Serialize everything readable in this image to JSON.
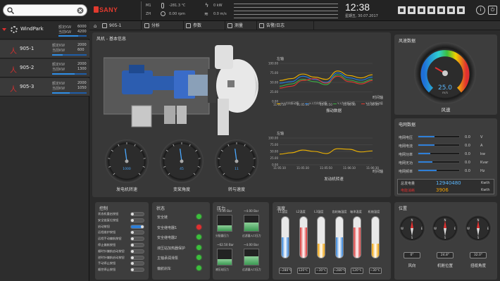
{
  "topbar": {
    "search_placeholder": "",
    "brand": "SANY",
    "m1_label": "M1",
    "zh_label": "ZH",
    "temp": "-281.3 ℃",
    "rpm": "0.00 rpm",
    "power": "0 kW",
    "wind": "0.0 m/s",
    "time": "12:38",
    "date": "星期五, 30.07.2017"
  },
  "nav": {
    "items": [
      "905-1",
      "分析",
      "参数",
      "测量",
      "告警/日志"
    ]
  },
  "sidebar": {
    "root": "WindPark",
    "root_rated_label": "额定KW",
    "root_rated": "6000",
    "root_cur_label": "当前KW",
    "root_cur": "4200",
    "turbines": [
      {
        "name": "905-1",
        "rated_label": "额定KW",
        "rated": "2000",
        "cur_label": "当前KW",
        "cur": "600",
        "fill": 0.3
      },
      {
        "name": "905-2",
        "rated_label": "额定KW",
        "rated": "2000",
        "cur_label": "当前KW",
        "cur": "1300",
        "fill": 0.65
      },
      {
        "name": "905-3",
        "rated_label": "额定KW",
        "rated": "2000",
        "cur_label": "当前KW",
        "cur": "1050",
        "fill": 0.52
      }
    ]
  },
  "main": {
    "title": "风机 - 基本信息",
    "gauges": [
      {
        "label": "发电机转速",
        "value": "1000"
      },
      {
        "label": "变桨角度",
        "value": "45"
      },
      {
        "label": "转与速度",
        "value": "11"
      }
    ]
  },
  "vib": {
    "ylabel": "左轴",
    "xlabel": "时间轴",
    "title": "振动数据",
    "legend": [
      "X-1方向振动值",
      "X-2方向振动值",
      "Y-1方向振动值",
      "Y-2方向振动值"
    ]
  },
  "mov": {
    "ylabel": "左轴",
    "xlabel": "时间轴",
    "title": "发动机转速"
  },
  "chart_data": [
    {
      "type": "line",
      "title": "振动数据",
      "ylabel": "左轴",
      "xlabel": "时间轴",
      "categories": [
        "11:05:10",
        "11:05:20",
        "11:05:30",
        "11:05:40",
        "11:05:50",
        "11:06:00",
        "11:06:10",
        "11:06:20",
        "11:06:30"
      ],
      "ylim": [
        0,
        100
      ],
      "series": [
        {
          "name": "X-1方向振动值",
          "color": "#f0b400",
          "values": [
            55,
            60,
            72,
            64,
            58,
            80,
            68,
            62,
            70
          ]
        },
        {
          "name": "X-2方向振动值",
          "color": "#1e7fe8",
          "values": [
            48,
            52,
            66,
            58,
            50,
            75,
            62,
            56,
            64
          ]
        },
        {
          "name": "Y-1方向振动值",
          "color": "#3cb043",
          "values": [
            40,
            46,
            58,
            52,
            44,
            70,
            56,
            50,
            58
          ]
        },
        {
          "name": "Y-2方向振动值",
          "color": "#e0382e",
          "values": [
            35,
            40,
            55,
            60,
            48,
            66,
            52,
            46,
            55
          ]
        }
      ]
    },
    {
      "type": "line",
      "title": "发动机转速",
      "ylabel": "左轴",
      "xlabel": "时间轴",
      "categories": [
        "11:05:10",
        "11:05:20",
        "11:05:30",
        "11:05:40",
        "11:05:50",
        "11:06:00",
        "11:06:10",
        "11:06:20",
        "11:06:30"
      ],
      "ylim": [
        0,
        100
      ],
      "series": [
        {
          "color": "#f0b400",
          "values": [
            40,
            45,
            55,
            50,
            42,
            60,
            58,
            48,
            52
          ]
        }
      ]
    }
  ],
  "wind": {
    "title": "风速数据",
    "value": "25.0",
    "unit": "m/s",
    "label": "风速"
  },
  "grid": {
    "title": "电网数据",
    "rows": [
      {
        "label": "电网电压",
        "value": "0.0",
        "unit": "V",
        "fill": 0.4
      },
      {
        "label": "电网电流",
        "value": "0.0",
        "unit": "A",
        "fill": 0.4
      },
      {
        "label": "电网功率",
        "value": "0.0",
        "unit": "kw",
        "fill": 0.3
      },
      {
        "label": "电网无功",
        "value": "0.0",
        "unit": "Kvar",
        "fill": 0.35
      },
      {
        "label": "电网频率",
        "value": "0.0",
        "unit": "Hz",
        "fill": 0.45
      }
    ],
    "gen_label": "总发电量",
    "gen_value": "12940480",
    "gen_unit": "Kwth",
    "cons_label": "电能消耗",
    "cons_value": "3906",
    "cons_unit": "Kwth"
  },
  "control": {
    "title": "控制",
    "items": [
      "状态机重启按钮",
      "安全链复位按钮",
      "启动按钮",
      "远程维护按钮",
      "远程手动偏航按钮",
      "停止偏航按钮",
      "顺时针偏航启动按钮",
      "逆时针偏航启动按钮",
      "手动停止按钮",
      "顺控停止按钮"
    ]
  },
  "status": {
    "title": "状态",
    "items": [
      "安全链",
      "安全继电器1",
      "安全继电器2",
      "液压站加热器保护",
      "主轴承润滑泵",
      "偏航刹车"
    ],
    "colors": [
      "#3cbf3c",
      "#e03030",
      "#3cbf3c",
      "#3cbf3c",
      "#3cbf3c",
      "#3cbf3c"
    ]
  },
  "pressure": {
    "title": "压力",
    "items": [
      {
        "value": "~4.00 Bar",
        "label": "分配器压力",
        "fill": 0.35
      },
      {
        "value": "~4.00 Bar",
        "label": "过滤器入口压力",
        "fill": 0.55
      },
      {
        "value": "~62.50 Bar",
        "label": "液压站压力",
        "fill": 0.35
      },
      {
        "value": "~4.00 Bar",
        "label": "过滤器入口压力",
        "fill": 0.55
      }
    ]
  },
  "temp": {
    "title": "温度",
    "items": [
      {
        "label": "L1温度",
        "value": "~280℃",
        "color": "#2e7fd8",
        "fill": 0.5
      },
      {
        "label": "L2温度",
        "value": "120℃",
        "color": "#d83030",
        "fill": 0.75
      },
      {
        "label": "L3温度",
        "value": "~30℃",
        "color": "#f0a000",
        "fill": 0.35
      },
      {
        "label": "齿轮箱温度",
        "value": "~280℃",
        "color": "#2e7fd8",
        "fill": 0.5
      },
      {
        "label": "轴承温度",
        "value": "120℃",
        "color": "#d83030",
        "fill": 0.75
      },
      {
        "label": "机舱温度",
        "value": "~30℃",
        "color": "#f0a000",
        "fill": 0.35
      }
    ]
  },
  "position": {
    "title": "位置",
    "items": [
      {
        "label": "风向",
        "value": "0°"
      },
      {
        "label": "机舱位置",
        "value": "24.8°"
      },
      {
        "label": "扭缆角度",
        "value": "32.0°"
      }
    ]
  }
}
